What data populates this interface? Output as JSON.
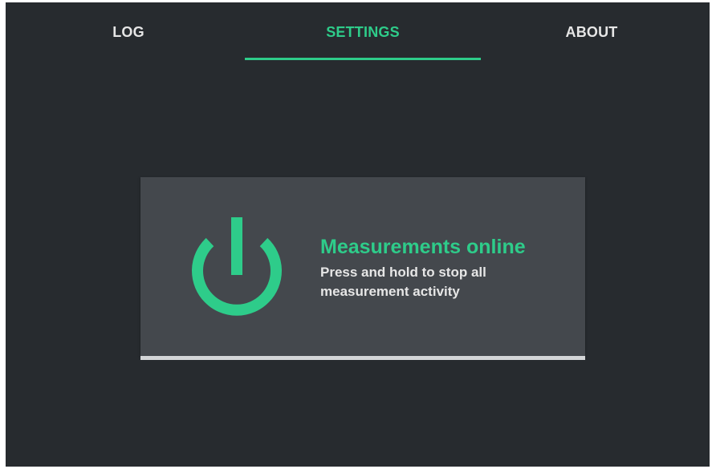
{
  "tabs": [
    {
      "label": "LOG",
      "active": false
    },
    {
      "label": "SETTINGS",
      "active": true
    },
    {
      "label": "ABOUT",
      "active": false
    }
  ],
  "power_toggle": {
    "icon": "power-icon",
    "status_title": "Measurements online",
    "hint": "Press and hold to stop all measurement activity",
    "hold_progress": 1.0
  },
  "colors": {
    "accent": "#2ecc8a",
    "background": "#272b2f",
    "card": "#44484d",
    "text": "#e6e6e6",
    "progress": "#d4d6d8"
  }
}
